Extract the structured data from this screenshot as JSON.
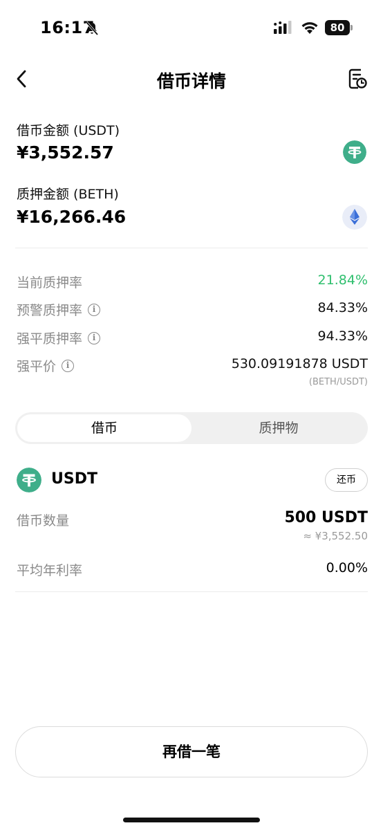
{
  "status_bar": {
    "time": "16:17",
    "battery": "80"
  },
  "header": {
    "title": "借币详情"
  },
  "borrow": {
    "label": "借币金额 (USDT)",
    "value": "¥3,552.57",
    "icon": "tether-icon"
  },
  "collateral": {
    "label": "质押金额 (BETH)",
    "value": "¥16,266.46",
    "icon": "ethereum-icon"
  },
  "info_rows": [
    {
      "label": "当前质押率",
      "value": "21.84%"
    },
    {
      "label": "预警质押率",
      "value": "84.33%"
    },
    {
      "label": "强平质押率",
      "value": "94.33%"
    },
    {
      "label": "强平价",
      "value": "530.09191878 USDT",
      "sub": "(BETH/USDT)"
    }
  ],
  "tabs": [
    {
      "label": "借币"
    },
    {
      "label": "质押物"
    }
  ],
  "loan": {
    "coin": "USDT",
    "repay_label": "还币",
    "amount_label": "借币数量",
    "amount_value": "500 USDT",
    "amount_approx": "≈ ¥3,552.50",
    "rate_label": "平均年利率",
    "rate_value": "0.00%"
  },
  "footer": {
    "borrow_again_label": "再借一笔"
  },
  "colors": {
    "green": "#2fbf6e",
    "tether": "#3fae8a",
    "eth_bg": "#e9edf8",
    "eth": "#3b6fd8"
  }
}
